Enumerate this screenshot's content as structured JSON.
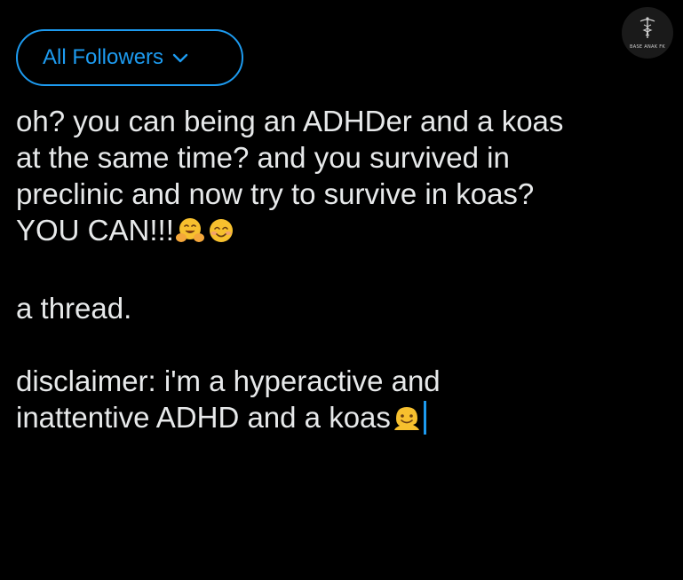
{
  "audience_selector": {
    "label": "All Followers",
    "icon": "chevron-down-icon",
    "accent_color": "#1d9bf0"
  },
  "watermark": {
    "text": "BASE ANAK FK",
    "icon": "caduceus-icon"
  },
  "composer": {
    "paragraph_1": {
      "line_1": "oh? you can being an ADHDer and a koas",
      "line_2": "at the same time? and you survived in",
      "line_3": "preclinic and now try to survive in koas?",
      "line_4": "YOU CAN!!!",
      "emojis": [
        "hugging-face-emoji",
        "smiling-face-emoji"
      ]
    },
    "paragraph_2": {
      "line_1": "a thread."
    },
    "paragraph_3": {
      "line_1": "disclaimer: i'm a hyperactive and",
      "line_2": "inattentive ADHD and a koas",
      "emojis": [
        "melting-face-emoji"
      ]
    },
    "caret_color": "#1d9bf0"
  },
  "colors": {
    "background": "#000000",
    "text": "#e7e9ea",
    "accent": "#1d9bf0"
  }
}
